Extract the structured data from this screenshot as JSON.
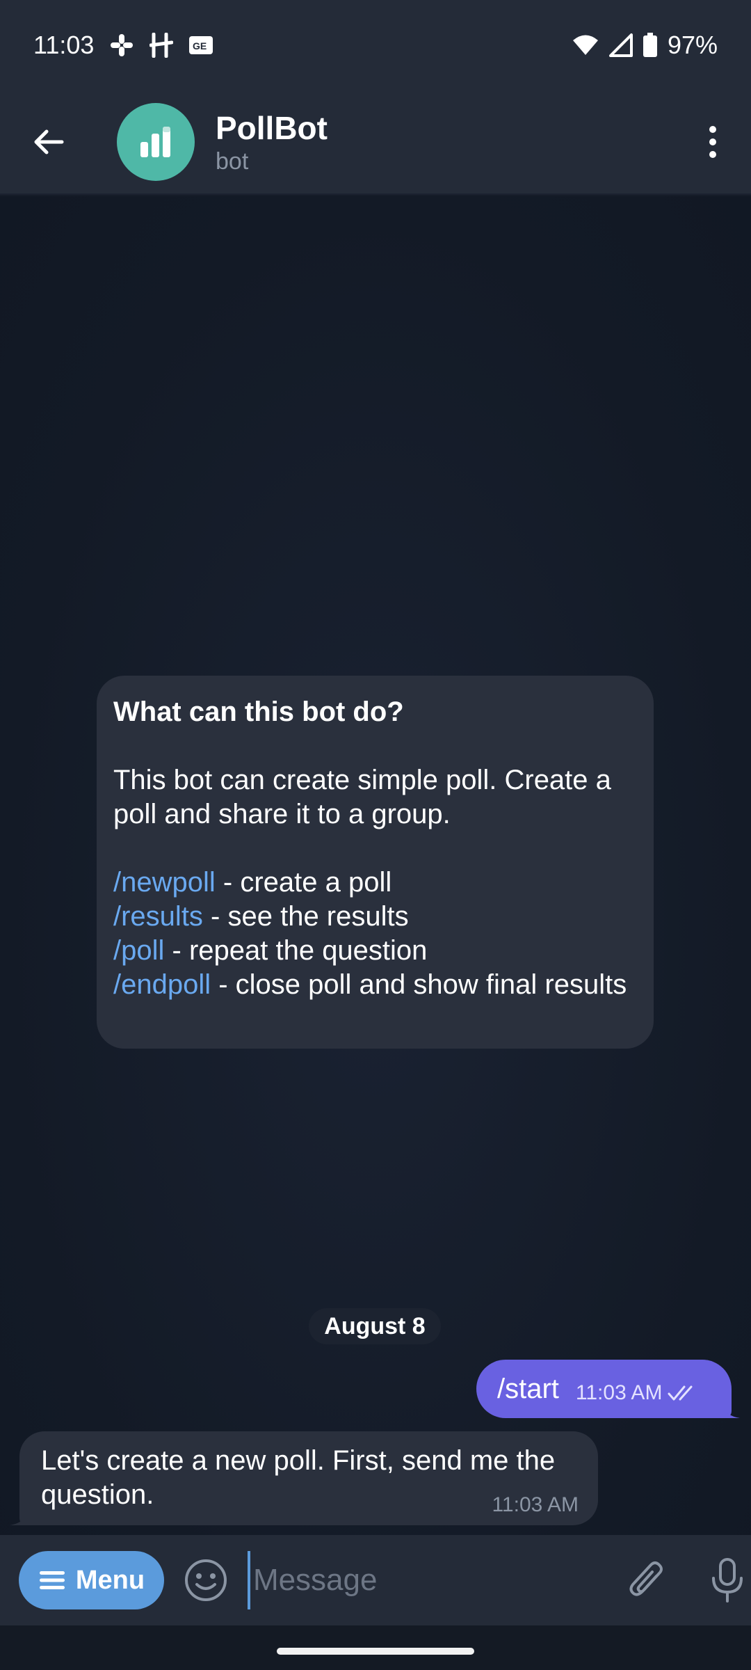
{
  "status_bar": {
    "time": "11:03",
    "battery": "97%",
    "icons": [
      "slack-icon",
      "hinge-icon",
      "news-icon",
      "wifi-icon",
      "signal-icon",
      "battery-icon"
    ]
  },
  "header": {
    "title": "PollBot",
    "subtitle": "bot",
    "avatar_color": "#4fb8a7"
  },
  "intro": {
    "title": "What can this bot do?",
    "description": "This bot can create simple poll. Create a poll and share it to a group.",
    "commands": [
      {
        "command": "/newpoll",
        "text": " - create a poll"
      },
      {
        "command": "/results",
        "text": " - see the results"
      },
      {
        "command": "/poll",
        "text": " - repeat the question"
      },
      {
        "command": "/endpoll",
        "text": " - close poll and show final results"
      }
    ]
  },
  "messages": {
    "date_divider": "August 8",
    "outgoing": {
      "text": "/start",
      "time": "11:03 AM"
    },
    "incoming": {
      "text": "Let's create a new poll. First, send me the question.",
      "time": "11:03 AM"
    }
  },
  "input_bar": {
    "menu_label": "Menu",
    "placeholder": "Message",
    "value": ""
  },
  "colors": {
    "accent": "#5b9bdc",
    "outgoing_bubble": "#6961e1",
    "link": "#6aa9f0"
  }
}
